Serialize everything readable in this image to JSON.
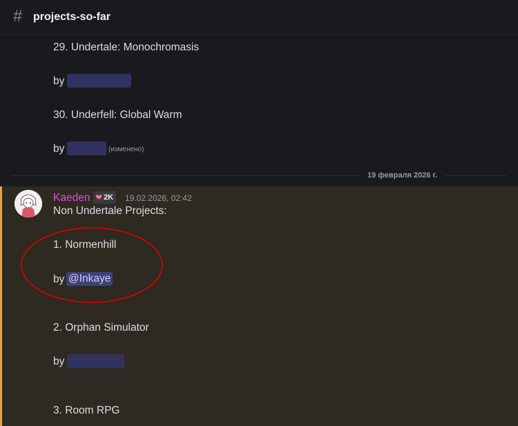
{
  "header": {
    "hash_glyph": "#",
    "channel_name": "projects-so-far"
  },
  "previous": {
    "items": [
      {
        "title": "29. Undertale: Monochromasis",
        "by": "by"
      },
      {
        "title": "30. Underfell: Global Warm",
        "by": "by",
        "edited": "(изменено)"
      }
    ]
  },
  "date_divider": "19 февраля 2026 г.",
  "message": {
    "author": "Kaeden",
    "badge": "2K",
    "timestamp": "19.02.2026, 02:42",
    "heading": "Non Undertale Projects:",
    "items": [
      {
        "title": "1. Normenhill",
        "by": "by",
        "mention": "@Inkaye"
      },
      {
        "title": "2. Orphan Simulator",
        "by": "by"
      },
      {
        "title": "3. Room RPG"
      }
    ]
  },
  "colors": {
    "author": "#e84bd9",
    "highlight_bg": "#2e2a22",
    "highlight_bar": "#e8a23c",
    "mention_bg": "#3e4278",
    "redaction": "#323260",
    "annotation_circle": "#e00000"
  }
}
